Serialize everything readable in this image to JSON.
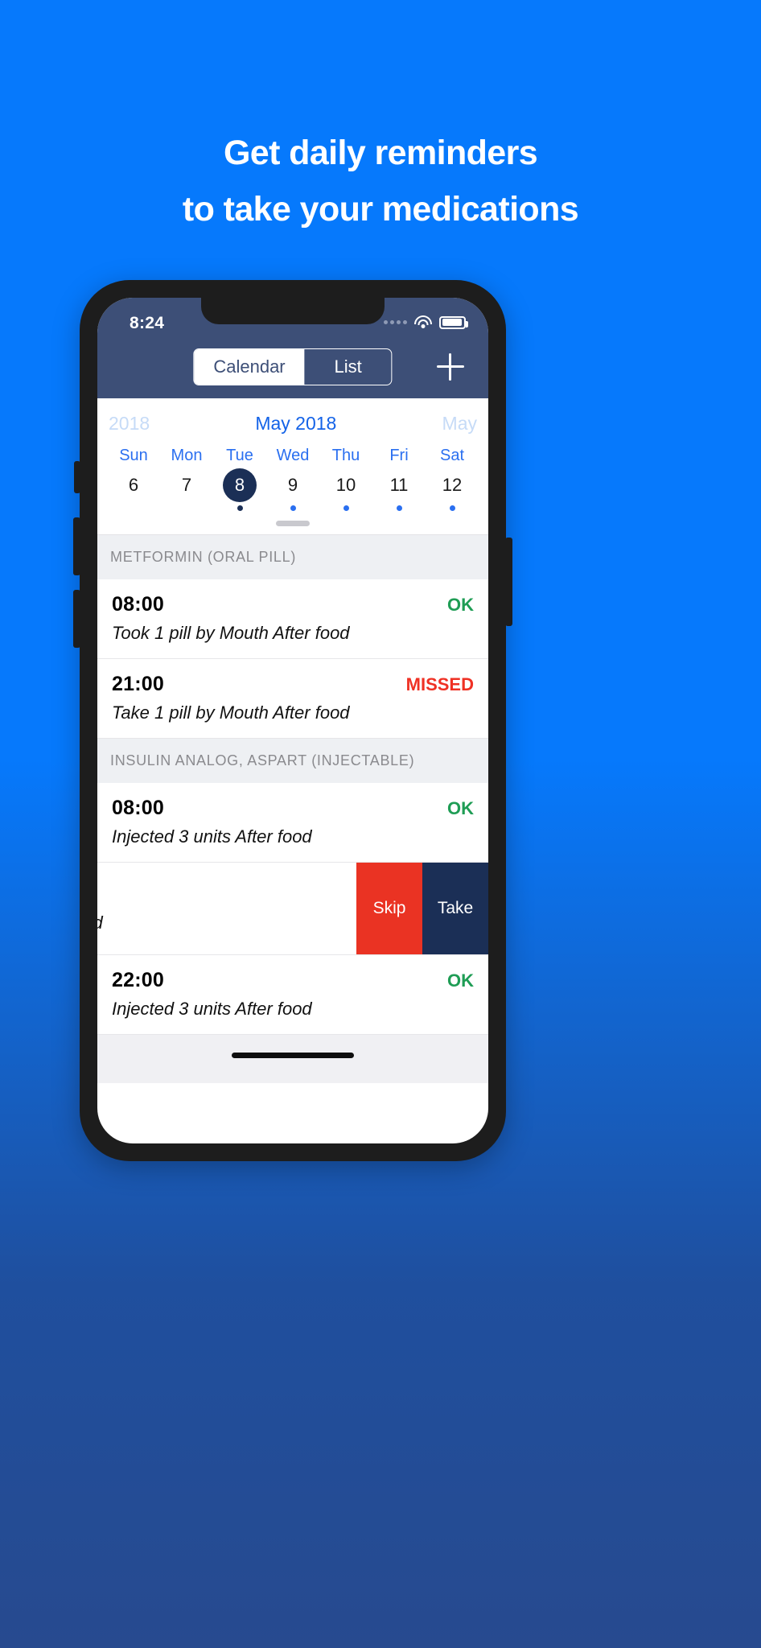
{
  "headline": {
    "line1": "Get daily reminders",
    "line2": "to take your medications"
  },
  "phone": {
    "status": {
      "time": "8:24",
      "signal_icon": "signal-dots-icon",
      "wifi_icon": "wifi-icon",
      "battery_icon": "battery-icon"
    },
    "navbar": {
      "segments": [
        {
          "label": "Calendar",
          "selected": true
        },
        {
          "label": "List",
          "selected": false
        }
      ],
      "add_icon": "plus-icon"
    },
    "calendar": {
      "month_prev": "2018",
      "month_current": "May 2018",
      "month_next": "May",
      "day_names": [
        "Sun",
        "Mon",
        "Tue",
        "Wed",
        "Thu",
        "Fri",
        "Sat"
      ],
      "dates": [
        {
          "num": "6",
          "selected": false,
          "dot": "none"
        },
        {
          "num": "7",
          "selected": false,
          "dot": "none"
        },
        {
          "num": "8",
          "selected": true,
          "dot": "dark"
        },
        {
          "num": "9",
          "selected": false,
          "dot": "blue"
        },
        {
          "num": "10",
          "selected": false,
          "dot": "blue"
        },
        {
          "num": "11",
          "selected": false,
          "dot": "blue"
        },
        {
          "num": "12",
          "selected": false,
          "dot": "blue"
        }
      ]
    },
    "sections": [
      {
        "title": "METFORMIN (ORAL PILL)",
        "items": [
          {
            "time": "08:00",
            "status": "OK",
            "status_kind": "ok",
            "desc": "Took 1 pill by Mouth After food"
          },
          {
            "time": "21:00",
            "status": "MISSED",
            "status_kind": "missed",
            "desc": "Take 1 pill by Mouth After food"
          }
        ]
      },
      {
        "title": "INSULIN ANALOG, ASPART (INJECTABLE)",
        "items": [
          {
            "time": "08:00",
            "status": "OK",
            "status_kind": "ok",
            "desc": "Injected 3 units After food"
          }
        ],
        "swiped_item": {
          "desc_partial": "ood",
          "actions": [
            {
              "label": "Skip",
              "kind": "skip"
            },
            {
              "label": "Take",
              "kind": "take"
            }
          ]
        },
        "items_after": [
          {
            "time": "22:00",
            "status": "OK",
            "status_kind": "ok",
            "desc": "Injected 3 units After food"
          }
        ]
      }
    ]
  }
}
